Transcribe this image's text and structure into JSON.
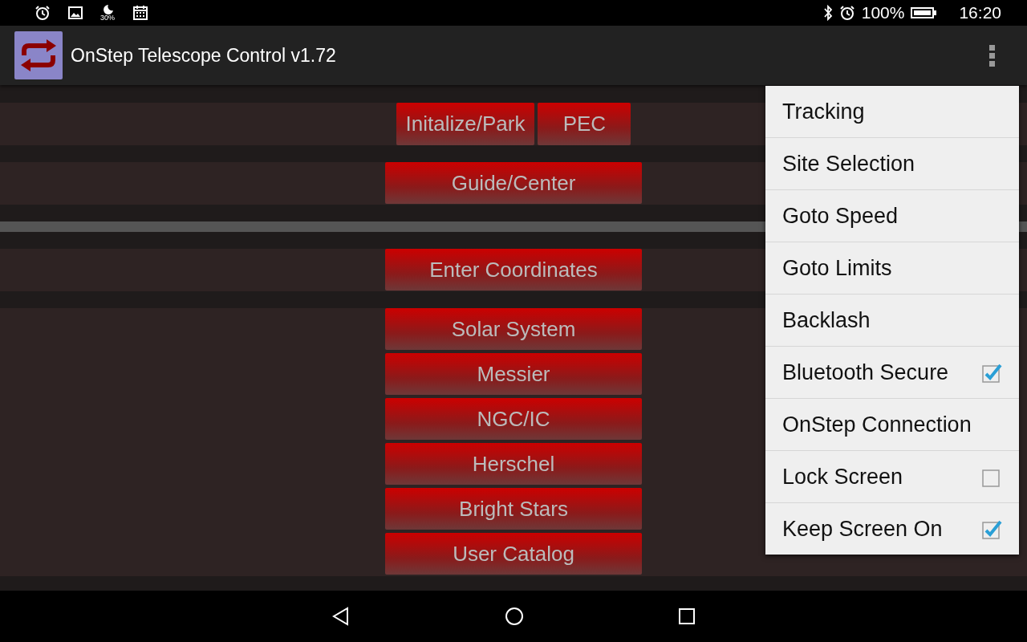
{
  "status_bar": {
    "moon_percent": "30%",
    "battery": "100%",
    "time": "16:20"
  },
  "app_bar": {
    "title": "OnStep Telescope Control v1.72"
  },
  "sections": [
    {
      "kind": "buttons",
      "buttons": [
        "Initalize/Park",
        "PEC"
      ]
    },
    {
      "kind": "buttons",
      "buttons": [
        "Guide/Center"
      ]
    },
    {
      "kind": "divider"
    },
    {
      "kind": "buttons",
      "buttons": [
        "Enter Coordinates"
      ]
    },
    {
      "kind": "stack",
      "buttons": [
        "Solar System",
        "Messier",
        "NGC/IC",
        "Herschel",
        "Bright Stars",
        "User Catalog"
      ]
    }
  ],
  "menu": [
    {
      "label": "Tracking",
      "kind": "plain"
    },
    {
      "label": "Site Selection",
      "kind": "plain"
    },
    {
      "label": "Goto Speed",
      "kind": "plain"
    },
    {
      "label": "Goto Limits",
      "kind": "plain"
    },
    {
      "label": "Backlash",
      "kind": "plain"
    },
    {
      "label": "Bluetooth Secure",
      "kind": "checkbox",
      "checked": true
    },
    {
      "label": "OnStep Connection",
      "kind": "plain"
    },
    {
      "label": "Lock Screen",
      "kind": "checkbox",
      "checked": false
    },
    {
      "label": "Keep Screen On",
      "kind": "checkbox",
      "checked": true
    }
  ]
}
